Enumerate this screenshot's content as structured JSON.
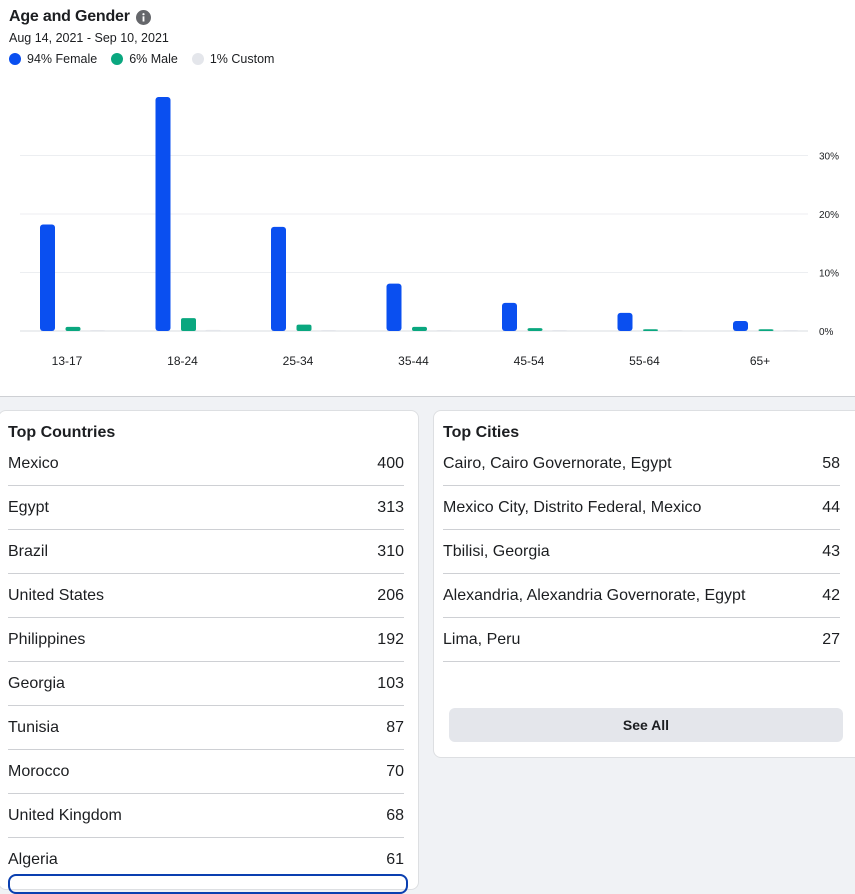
{
  "age_gender": {
    "title": "Age and Gender",
    "date_range": "Aug 14, 2021 - Sep 10, 2021",
    "legend": [
      {
        "label": "94% Female",
        "color": "#0a4ff0"
      },
      {
        "label": "6% Male",
        "color": "#0aa77f"
      },
      {
        "label": "1% Custom",
        "color": "#e4e6eb"
      }
    ]
  },
  "chart_data": {
    "type": "bar",
    "categories": [
      "13-17",
      "18-24",
      "25-34",
      "35-44",
      "45-54",
      "55-64",
      "65+"
    ],
    "series": [
      {
        "name": "Female",
        "values": [
          18.2,
          40.0,
          17.8,
          8.1,
          4.8,
          3.1,
          1.7
        ],
        "color": "#0a4ff0"
      },
      {
        "name": "Male",
        "values": [
          0.7,
          2.2,
          1.1,
          0.7,
          0.5,
          0.3,
          0.3
        ],
        "color": "#0aa77f"
      },
      {
        "name": "Custom",
        "values": [
          0.1,
          0.2,
          0.1,
          0.05,
          0.05,
          0.02,
          0.02
        ],
        "color": "#e4e6eb"
      }
    ],
    "yticks": [
      "0%",
      "10%",
      "20%",
      "30%"
    ],
    "ylim": [
      0,
      40
    ],
    "grid": true
  },
  "top_countries": {
    "title": "Top Countries",
    "rows": [
      {
        "name": "Mexico",
        "value": "400"
      },
      {
        "name": "Egypt",
        "value": "313"
      },
      {
        "name": "Brazil",
        "value": "310"
      },
      {
        "name": "United States",
        "value": "206"
      },
      {
        "name": "Philippines",
        "value": "192"
      },
      {
        "name": "Georgia",
        "value": "103"
      },
      {
        "name": "Tunisia",
        "value": "87"
      },
      {
        "name": "Morocco",
        "value": "70"
      },
      {
        "name": "United Kingdom",
        "value": "68"
      },
      {
        "name": "Algeria",
        "value": "61"
      }
    ]
  },
  "top_cities": {
    "title": "Top Cities",
    "rows": [
      {
        "name": "Cairo, Cairo Governorate, Egypt",
        "value": "58"
      },
      {
        "name": "Mexico City, Distrito Federal, Mexico",
        "value": "44"
      },
      {
        "name": "Tbilisi, Georgia",
        "value": "43"
      },
      {
        "name": "Alexandria, Alexandria Governorate, Egypt",
        "value": "42"
      },
      {
        "name": "Lima, Peru",
        "value": "27"
      }
    ],
    "see_all_label": "See All"
  }
}
